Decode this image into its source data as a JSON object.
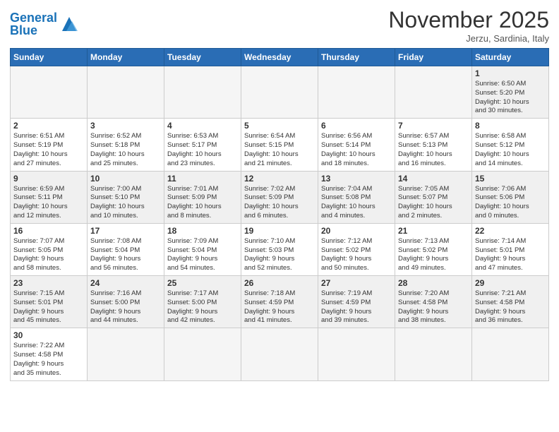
{
  "header": {
    "logo_general": "General",
    "logo_blue": "Blue",
    "month": "November 2025",
    "location": "Jerzu, Sardinia, Italy"
  },
  "weekdays": [
    "Sunday",
    "Monday",
    "Tuesday",
    "Wednesday",
    "Thursday",
    "Friday",
    "Saturday"
  ],
  "weeks": [
    [
      {
        "day": "",
        "info": ""
      },
      {
        "day": "",
        "info": ""
      },
      {
        "day": "",
        "info": ""
      },
      {
        "day": "",
        "info": ""
      },
      {
        "day": "",
        "info": ""
      },
      {
        "day": "",
        "info": ""
      },
      {
        "day": "1",
        "info": "Sunrise: 6:50 AM\nSunset: 5:20 PM\nDaylight: 10 hours\nand 30 minutes."
      }
    ],
    [
      {
        "day": "2",
        "info": "Sunrise: 6:51 AM\nSunset: 5:19 PM\nDaylight: 10 hours\nand 27 minutes."
      },
      {
        "day": "3",
        "info": "Sunrise: 6:52 AM\nSunset: 5:18 PM\nDaylight: 10 hours\nand 25 minutes."
      },
      {
        "day": "4",
        "info": "Sunrise: 6:53 AM\nSunset: 5:17 PM\nDaylight: 10 hours\nand 23 minutes."
      },
      {
        "day": "5",
        "info": "Sunrise: 6:54 AM\nSunset: 5:15 PM\nDaylight: 10 hours\nand 21 minutes."
      },
      {
        "day": "6",
        "info": "Sunrise: 6:56 AM\nSunset: 5:14 PM\nDaylight: 10 hours\nand 18 minutes."
      },
      {
        "day": "7",
        "info": "Sunrise: 6:57 AM\nSunset: 5:13 PM\nDaylight: 10 hours\nand 16 minutes."
      },
      {
        "day": "8",
        "info": "Sunrise: 6:58 AM\nSunset: 5:12 PM\nDaylight: 10 hours\nand 14 minutes."
      }
    ],
    [
      {
        "day": "9",
        "info": "Sunrise: 6:59 AM\nSunset: 5:11 PM\nDaylight: 10 hours\nand 12 minutes."
      },
      {
        "day": "10",
        "info": "Sunrise: 7:00 AM\nSunset: 5:10 PM\nDaylight: 10 hours\nand 10 minutes."
      },
      {
        "day": "11",
        "info": "Sunrise: 7:01 AM\nSunset: 5:09 PM\nDaylight: 10 hours\nand 8 minutes."
      },
      {
        "day": "12",
        "info": "Sunrise: 7:02 AM\nSunset: 5:09 PM\nDaylight: 10 hours\nand 6 minutes."
      },
      {
        "day": "13",
        "info": "Sunrise: 7:04 AM\nSunset: 5:08 PM\nDaylight: 10 hours\nand 4 minutes."
      },
      {
        "day": "14",
        "info": "Sunrise: 7:05 AM\nSunset: 5:07 PM\nDaylight: 10 hours\nand 2 minutes."
      },
      {
        "day": "15",
        "info": "Sunrise: 7:06 AM\nSunset: 5:06 PM\nDaylight: 10 hours\nand 0 minutes."
      }
    ],
    [
      {
        "day": "16",
        "info": "Sunrise: 7:07 AM\nSunset: 5:05 PM\nDaylight: 9 hours\nand 58 minutes."
      },
      {
        "day": "17",
        "info": "Sunrise: 7:08 AM\nSunset: 5:04 PM\nDaylight: 9 hours\nand 56 minutes."
      },
      {
        "day": "18",
        "info": "Sunrise: 7:09 AM\nSunset: 5:04 PM\nDaylight: 9 hours\nand 54 minutes."
      },
      {
        "day": "19",
        "info": "Sunrise: 7:10 AM\nSunset: 5:03 PM\nDaylight: 9 hours\nand 52 minutes."
      },
      {
        "day": "20",
        "info": "Sunrise: 7:12 AM\nSunset: 5:02 PM\nDaylight: 9 hours\nand 50 minutes."
      },
      {
        "day": "21",
        "info": "Sunrise: 7:13 AM\nSunset: 5:02 PM\nDaylight: 9 hours\nand 49 minutes."
      },
      {
        "day": "22",
        "info": "Sunrise: 7:14 AM\nSunset: 5:01 PM\nDaylight: 9 hours\nand 47 minutes."
      }
    ],
    [
      {
        "day": "23",
        "info": "Sunrise: 7:15 AM\nSunset: 5:01 PM\nDaylight: 9 hours\nand 45 minutes."
      },
      {
        "day": "24",
        "info": "Sunrise: 7:16 AM\nSunset: 5:00 PM\nDaylight: 9 hours\nand 44 minutes."
      },
      {
        "day": "25",
        "info": "Sunrise: 7:17 AM\nSunset: 5:00 PM\nDaylight: 9 hours\nand 42 minutes."
      },
      {
        "day": "26",
        "info": "Sunrise: 7:18 AM\nSunset: 4:59 PM\nDaylight: 9 hours\nand 41 minutes."
      },
      {
        "day": "27",
        "info": "Sunrise: 7:19 AM\nSunset: 4:59 PM\nDaylight: 9 hours\nand 39 minutes."
      },
      {
        "day": "28",
        "info": "Sunrise: 7:20 AM\nSunset: 4:58 PM\nDaylight: 9 hours\nand 38 minutes."
      },
      {
        "day": "29",
        "info": "Sunrise: 7:21 AM\nSunset: 4:58 PM\nDaylight: 9 hours\nand 36 minutes."
      }
    ],
    [
      {
        "day": "30",
        "info": "Sunrise: 7:22 AM\nSunset: 4:58 PM\nDaylight: 9 hours\nand 35 minutes."
      },
      {
        "day": "",
        "info": ""
      },
      {
        "day": "",
        "info": ""
      },
      {
        "day": "",
        "info": ""
      },
      {
        "day": "",
        "info": ""
      },
      {
        "day": "",
        "info": ""
      },
      {
        "day": "",
        "info": ""
      }
    ]
  ]
}
